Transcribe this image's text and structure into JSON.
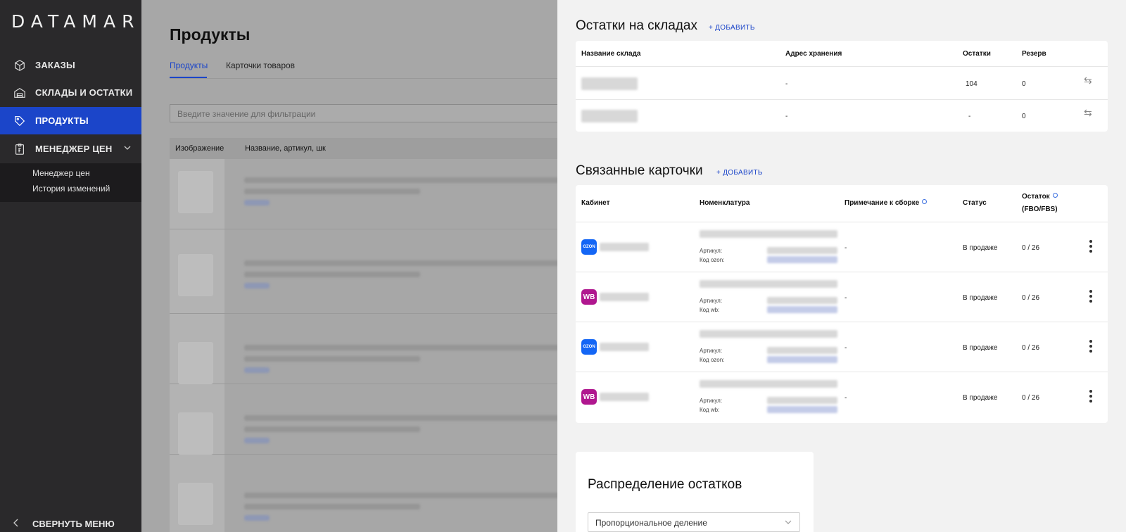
{
  "app": {
    "logo": "DATAMARKT"
  },
  "sidebar": {
    "items": [
      {
        "label": "ЗАКАЗЫ",
        "icon": "box-icon"
      },
      {
        "label": "СКЛАДЫ И ОСТАТКИ",
        "icon": "warehouse-icon"
      },
      {
        "label": "ПРОДУКТЫ",
        "icon": "tag-icon",
        "active": true
      },
      {
        "label": "МЕНЕДЖЕР ЦЕН",
        "icon": "price-list-icon"
      }
    ],
    "submenu": [
      "Менеджер цен",
      "История изменений"
    ],
    "collapse_label": "СВЕРНУТЬ МЕНЮ"
  },
  "main": {
    "title": "Продукты",
    "tabs": [
      "Продукты",
      "Карточки товаров"
    ],
    "filter_placeholder": "Введите значение для фильтрации",
    "columns": [
      "Изображение",
      "Название, артикул, шк"
    ]
  },
  "drawer": {
    "stock": {
      "title": "Остатки на складах",
      "add_label": "+ ДОБАВИТЬ",
      "columns": [
        "Название склада",
        "Адрес хранения",
        "Остатки",
        "Резерв"
      ],
      "rows": [
        {
          "address": "-",
          "stock": "104",
          "reserve": "0"
        },
        {
          "address": "-",
          "stock": "-",
          "reserve": "0"
        }
      ]
    },
    "linked": {
      "title": "Связанные карточки",
      "add_label": "+ ДОБАВИТЬ",
      "columns": [
        "Кабинет",
        "Номенклатура",
        "Примечание к сборке",
        "Статус",
        "Остаток",
        "(FBO/FBS)"
      ],
      "rows": [
        {
          "marketplace": "ozon",
          "logo_text": "OZON",
          "article_label": "Артикул:",
          "code_label": "Код ozon:",
          "note": "-",
          "status": "В продаже",
          "stock": "0 / 26"
        },
        {
          "marketplace": "wb",
          "logo_text": "WB",
          "article_label": "Артикул:",
          "code_label": "Код wb:",
          "note": "-",
          "status": "В продаже",
          "stock": "0 / 26"
        },
        {
          "marketplace": "ozon",
          "logo_text": "OZON",
          "article_label": "Артикул:",
          "code_label": "Код ozon:",
          "note": "-",
          "status": "В продаже",
          "stock": "0 / 26"
        },
        {
          "marketplace": "wb",
          "logo_text": "WB",
          "article_label": "Артикул:",
          "code_label": "Код wb:",
          "note": "-",
          "status": "В продаже",
          "stock": "0 / 26"
        }
      ]
    },
    "distribution": {
      "title": "Распределение остатков",
      "select_value": "Пропорциональное деление"
    }
  },
  "colors": {
    "accent": "#1b45c9",
    "sidebar_bg": "#2a292b",
    "ozon": "#1466f5",
    "wb": "#b0178f"
  }
}
